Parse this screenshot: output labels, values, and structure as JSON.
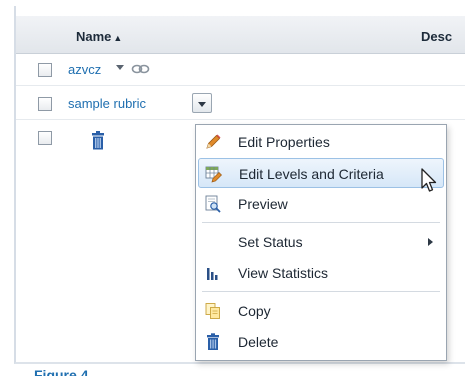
{
  "table": {
    "columns": {
      "name": "Name",
      "sort_indicator": "▲",
      "description": "Desc"
    },
    "rows": [
      {
        "name": "azvcz"
      },
      {
        "name": "sample rubric"
      }
    ]
  },
  "context_menu": {
    "items": [
      {
        "label": "Edit Properties",
        "icon": "pencil-icon"
      },
      {
        "label": "Edit Levels and Criteria",
        "icon": "grid-pencil-icon",
        "highlighted": true
      },
      {
        "label": "Preview",
        "icon": "preview-icon"
      },
      {
        "label": "Set Status",
        "icon": "none",
        "has_submenu": true
      },
      {
        "label": "View Statistics",
        "icon": "bar-chart-icon"
      },
      {
        "label": "Copy",
        "icon": "copy-icon"
      },
      {
        "label": "Delete",
        "icon": "trash-icon"
      }
    ]
  },
  "footer": {
    "partial_text": "Figure 4"
  },
  "colors": {
    "link": "#1f6fb0",
    "highlight_bg": "#d6e7f8",
    "highlight_border": "#9cc1e5",
    "trash_blue": "#2a5fa8"
  }
}
